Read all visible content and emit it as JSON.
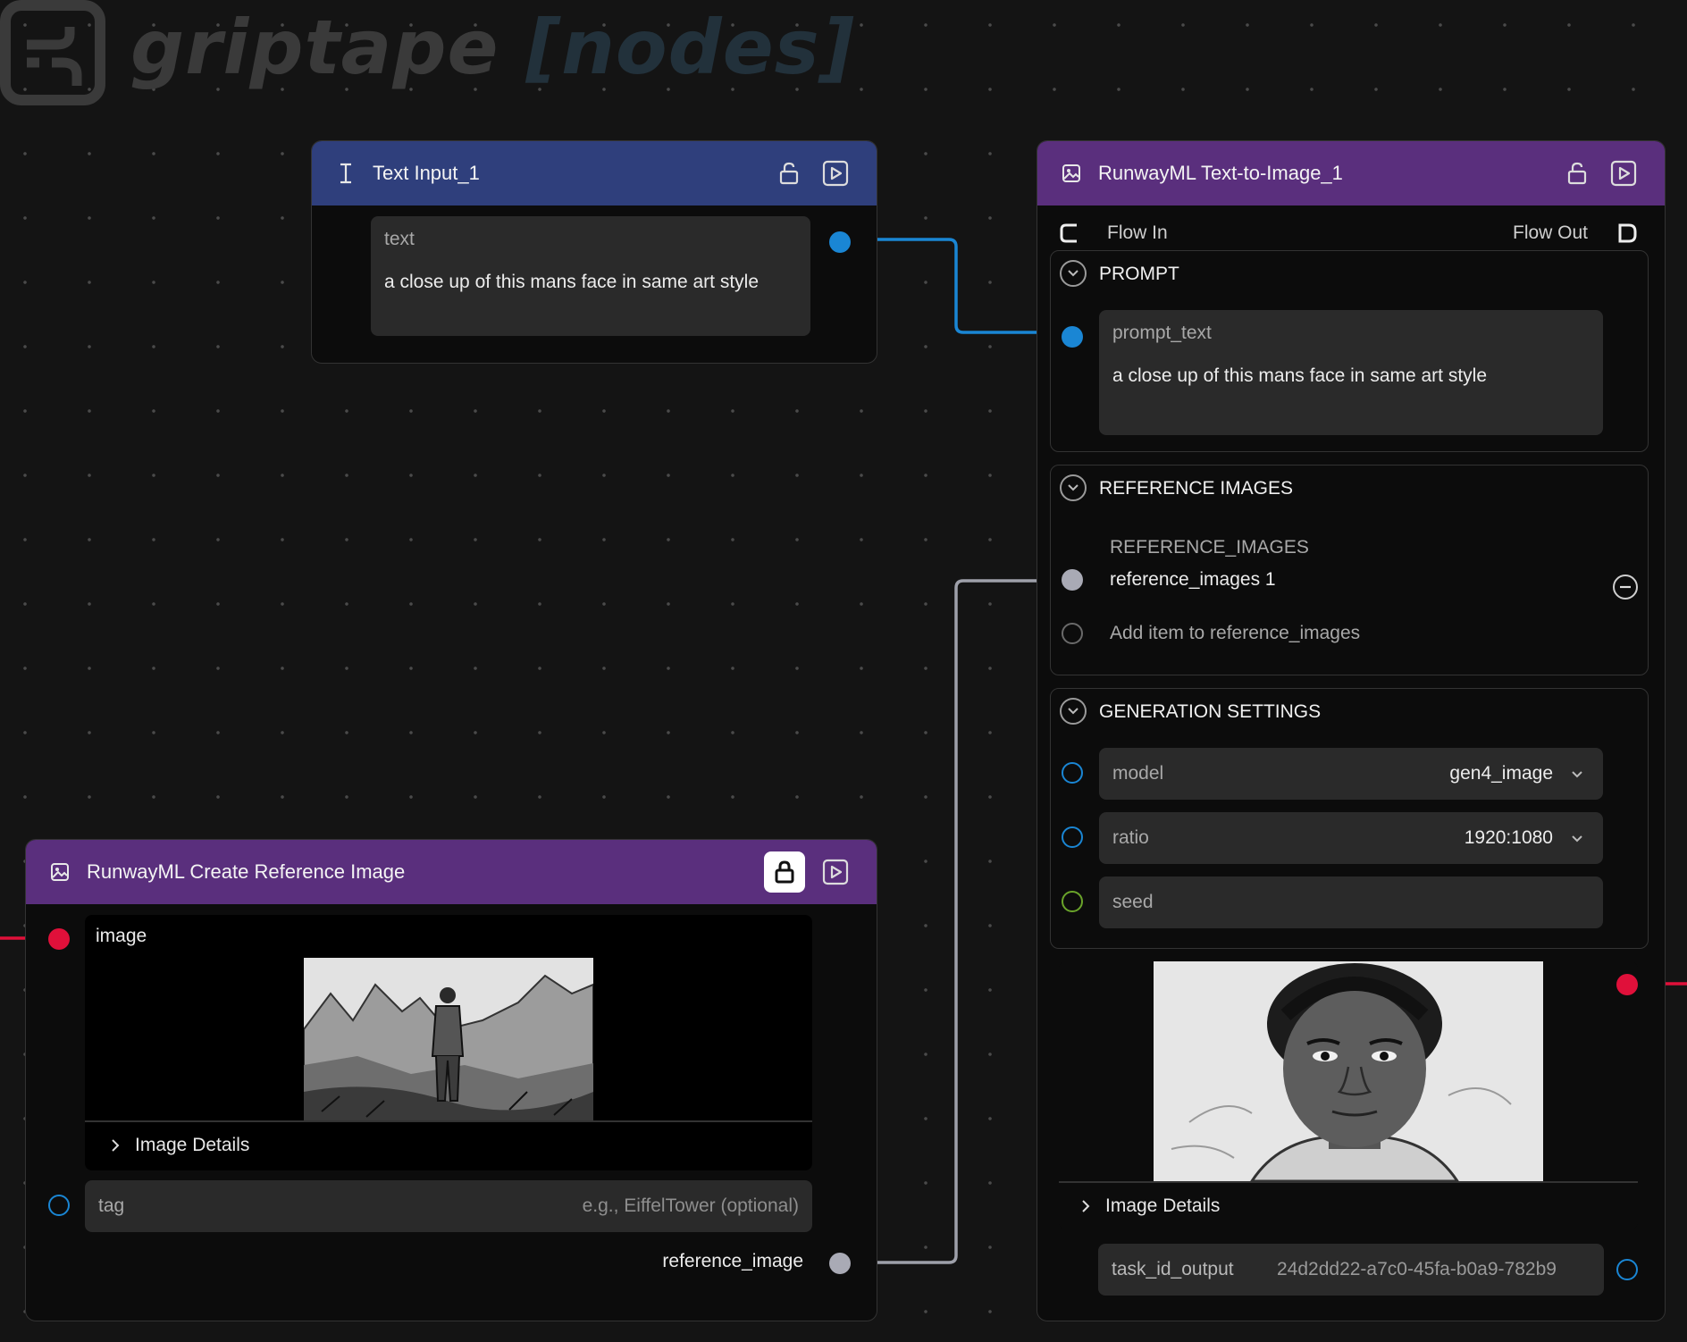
{
  "brand": {
    "name": "griptape",
    "suffix": "[nodes]"
  },
  "text_input_node": {
    "title": "Text Input_1",
    "field_label": "text",
    "field_value": "a close up of this mans face in same art style"
  },
  "t2i_node": {
    "title": "RunwayML Text-to-Image_1",
    "flow_in": "Flow In",
    "flow_out": "Flow Out",
    "prompt_section": {
      "title": "PROMPT",
      "field_label": "prompt_text",
      "field_value": "a close up of this mans face in same art style"
    },
    "ref_section": {
      "title": "REFERENCE IMAGES",
      "list_label": "REFERENCE_IMAGES",
      "items": [
        "reference_images 1"
      ],
      "add_label": "Add item to reference_images"
    },
    "gen_section": {
      "title": "GENERATION SETTINGS",
      "model_label": "model",
      "model_value": "gen4_image",
      "ratio_label": "ratio",
      "ratio_value": "1920:1080",
      "seed_label": "seed"
    },
    "image_details": "Image Details",
    "task_label": "task_id_output",
    "task_value": "24d2dd22-a7c0-45fa-b0a9-782b9"
  },
  "ref_node": {
    "title": "RunwayML Create Reference Image",
    "image_label": "image",
    "image_details": "Image Details",
    "tag_label": "tag",
    "tag_placeholder": "e.g., EiffelTower (optional)",
    "output_label": "reference_image"
  },
  "colors": {
    "blue_header": "#2f3f7c",
    "purple_header": "#5a2f7d",
    "string_port": "#1a86d4",
    "image_port": "#e0103a",
    "ref_port": "#a9aab5"
  }
}
